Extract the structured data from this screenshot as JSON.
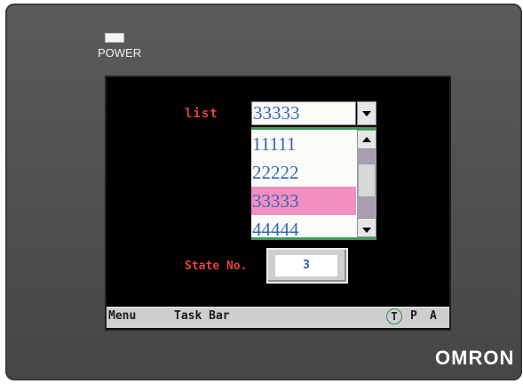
{
  "device": {
    "power_label": "POWER",
    "brand": "OMRON"
  },
  "screen": {
    "list_label": "list",
    "combo": {
      "value": "33333"
    },
    "list_items": [
      "11111",
      "22222",
      "33333",
      "44444"
    ],
    "selected_item": "33333",
    "state_label": "State No.",
    "state_value": "3"
  },
  "task_bar": {
    "menu_label": "Menu",
    "task_bar_label": "Task Bar",
    "t_label": "T",
    "p_label": "P",
    "a_label": "A"
  },
  "colors": {
    "label_red": "#e4423a",
    "list_text_blue": "#3468b8",
    "selection_pink": "#f28fc0",
    "list_border_green": "#3f9a5c",
    "scroll_track": "#a89eb0"
  },
  "icons": [
    "combo-dropdown-arrow-icon",
    "scroll-up-arrow-icon",
    "scroll-down-arrow-icon",
    "power-led-icon"
  ]
}
